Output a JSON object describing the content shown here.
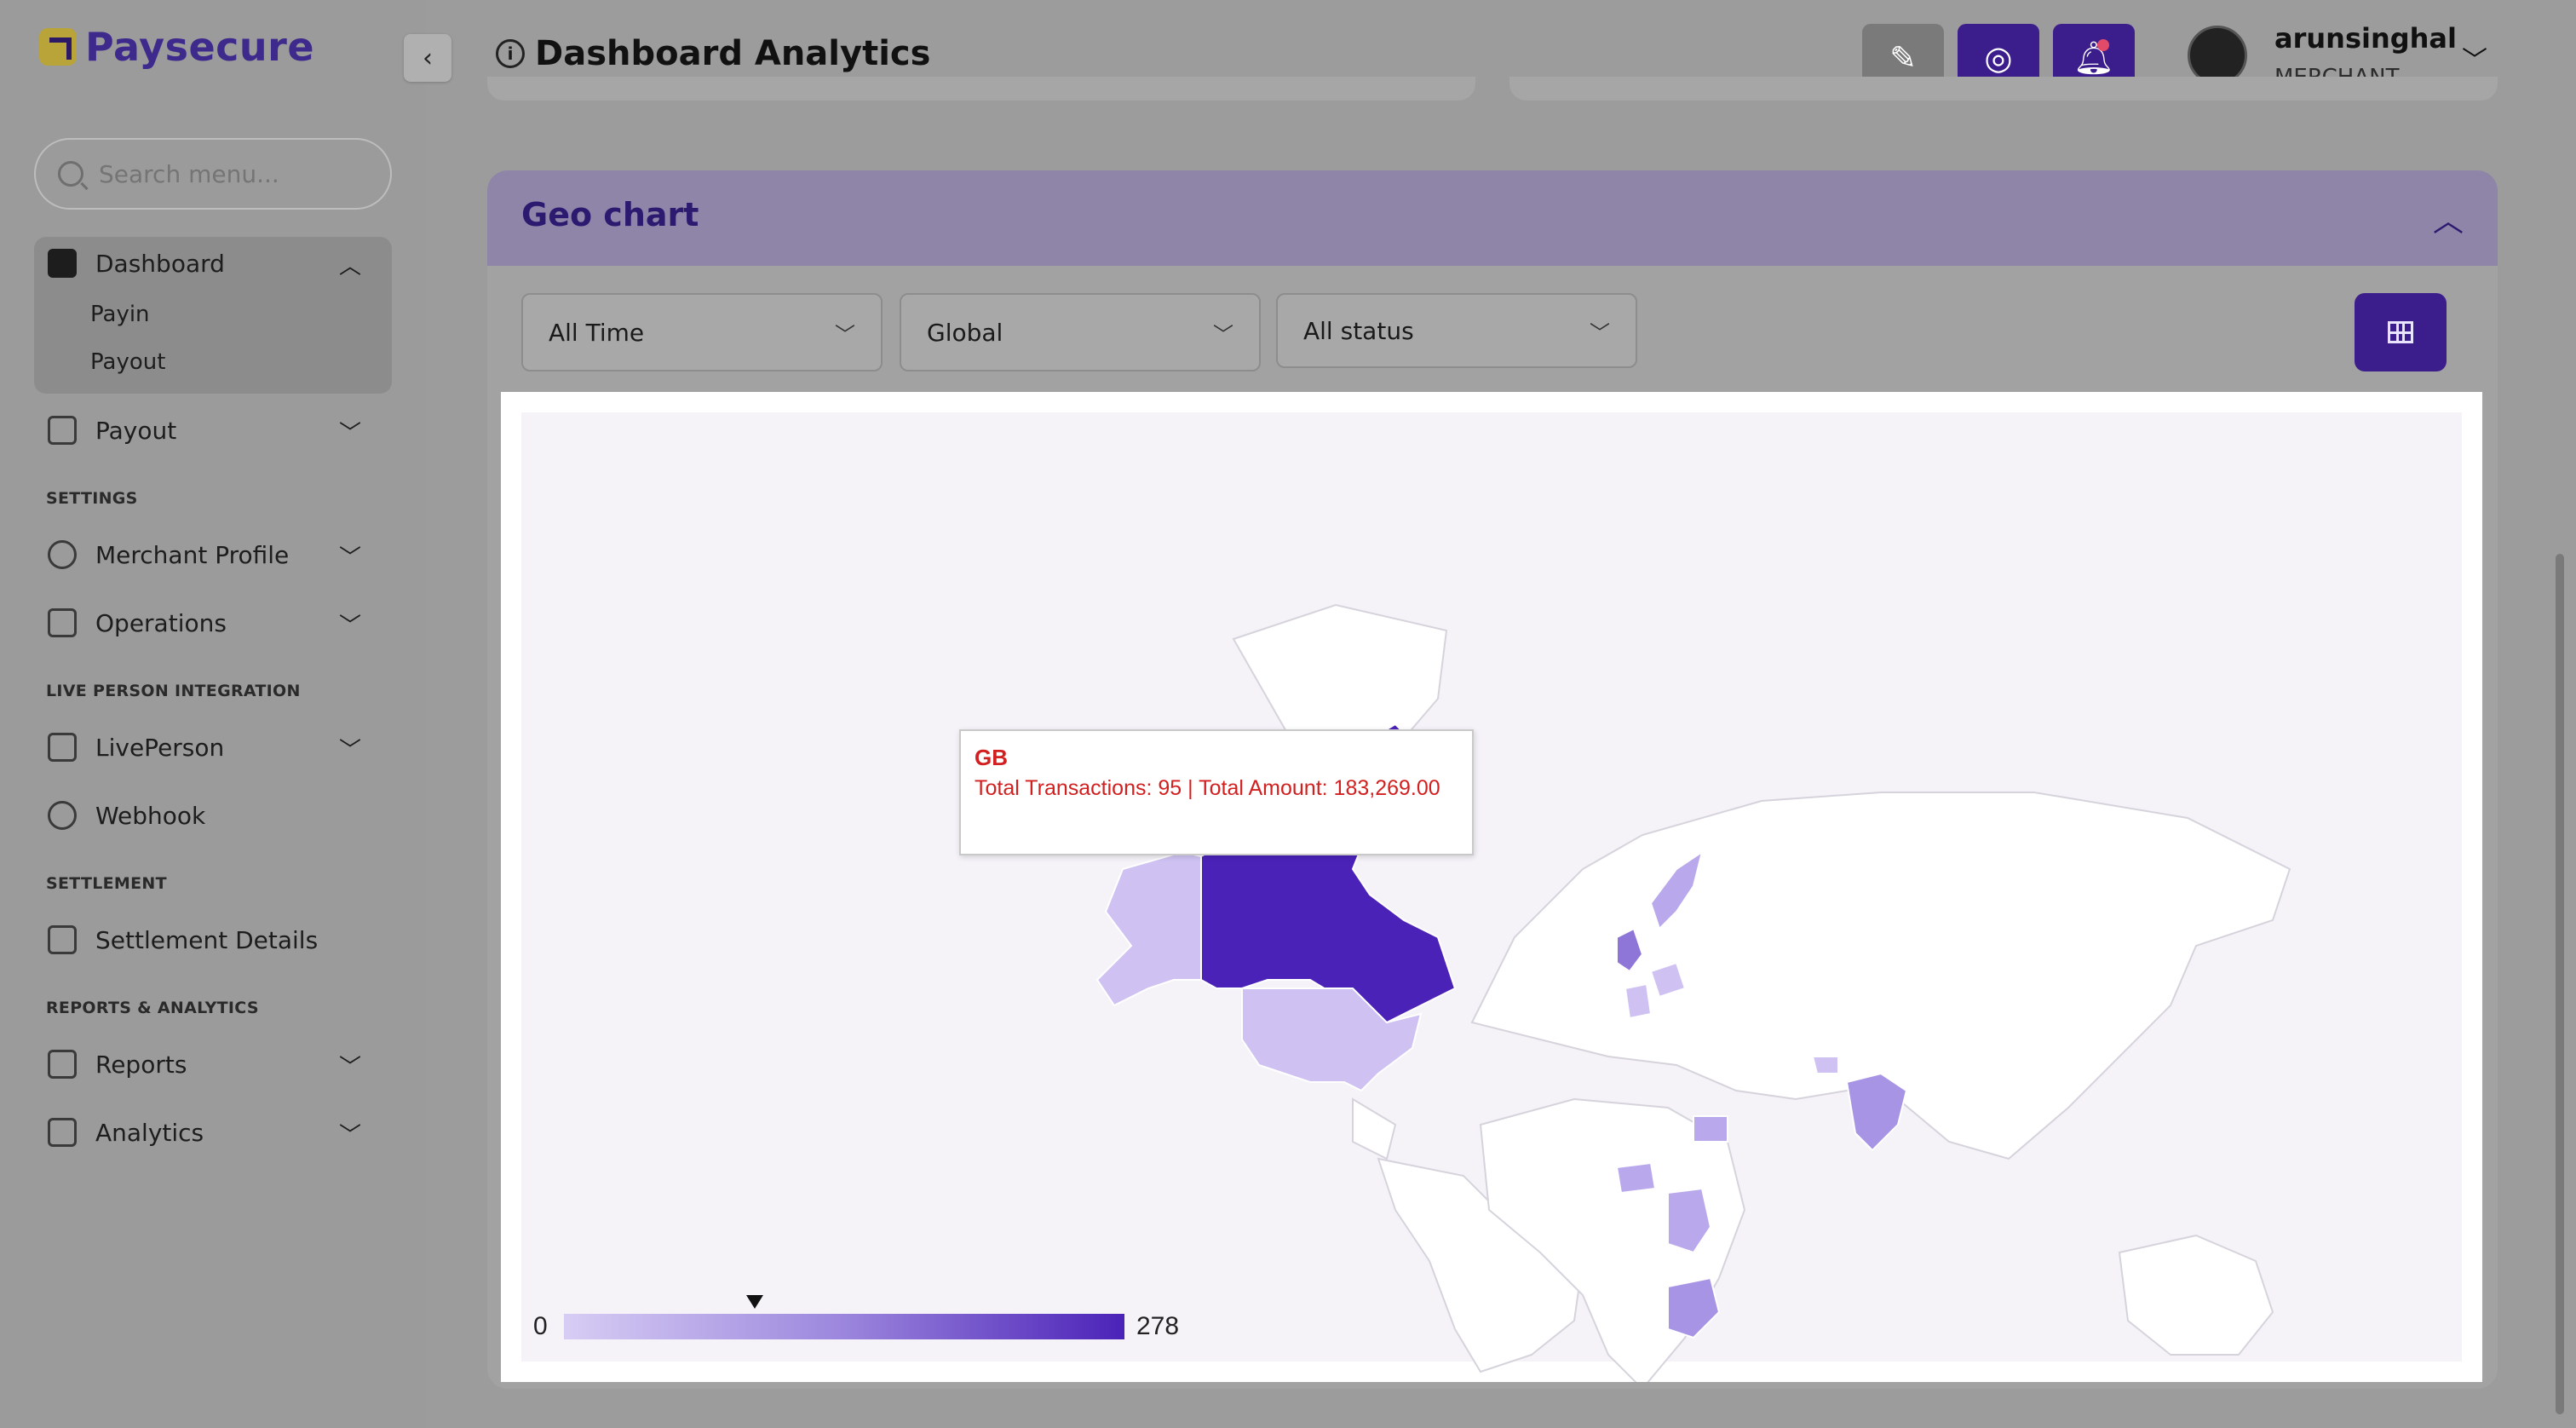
{
  "brand": {
    "name": "Paysecure"
  },
  "search": {
    "placeholder": "Search menu..."
  },
  "sidebar": {
    "dashboard": {
      "label": "Dashboard",
      "children": [
        "Payin",
        "Payout"
      ]
    },
    "items": [
      {
        "label": "Payout"
      },
      {
        "label": "Merchant Profile"
      },
      {
        "label": "Operations"
      },
      {
        "label": "LivePerson"
      },
      {
        "label": "Webhook"
      },
      {
        "label": "Settlement Details"
      },
      {
        "label": "Reports"
      },
      {
        "label": "Analytics"
      }
    ],
    "sections": [
      "SETTINGS",
      "LIVE PERSON INTEGRATION",
      "SETTLEMENT",
      "REPORTS & ANALYTICS"
    ]
  },
  "header": {
    "title": "Dashboard Analytics"
  },
  "user": {
    "name": "arunsinghal",
    "role": "MERCHANT"
  },
  "geo": {
    "title": "Geo chart",
    "filters": {
      "period": "All Time",
      "region": "Global",
      "status": "All status"
    }
  },
  "tooltip": {
    "code": "GB",
    "line": "Total Transactions: 95 |  Total Amount: 183,269.00",
    "transactions": 95,
    "amount": "183,269.00"
  },
  "legend": {
    "min": "0",
    "max": "278",
    "marker_fraction": 0.34
  },
  "colors": {
    "brand": "#3b1e8c",
    "map_high": "#4b22b8",
    "map_low": "#d7cdf4",
    "tooltip_text": "#d22020"
  }
}
